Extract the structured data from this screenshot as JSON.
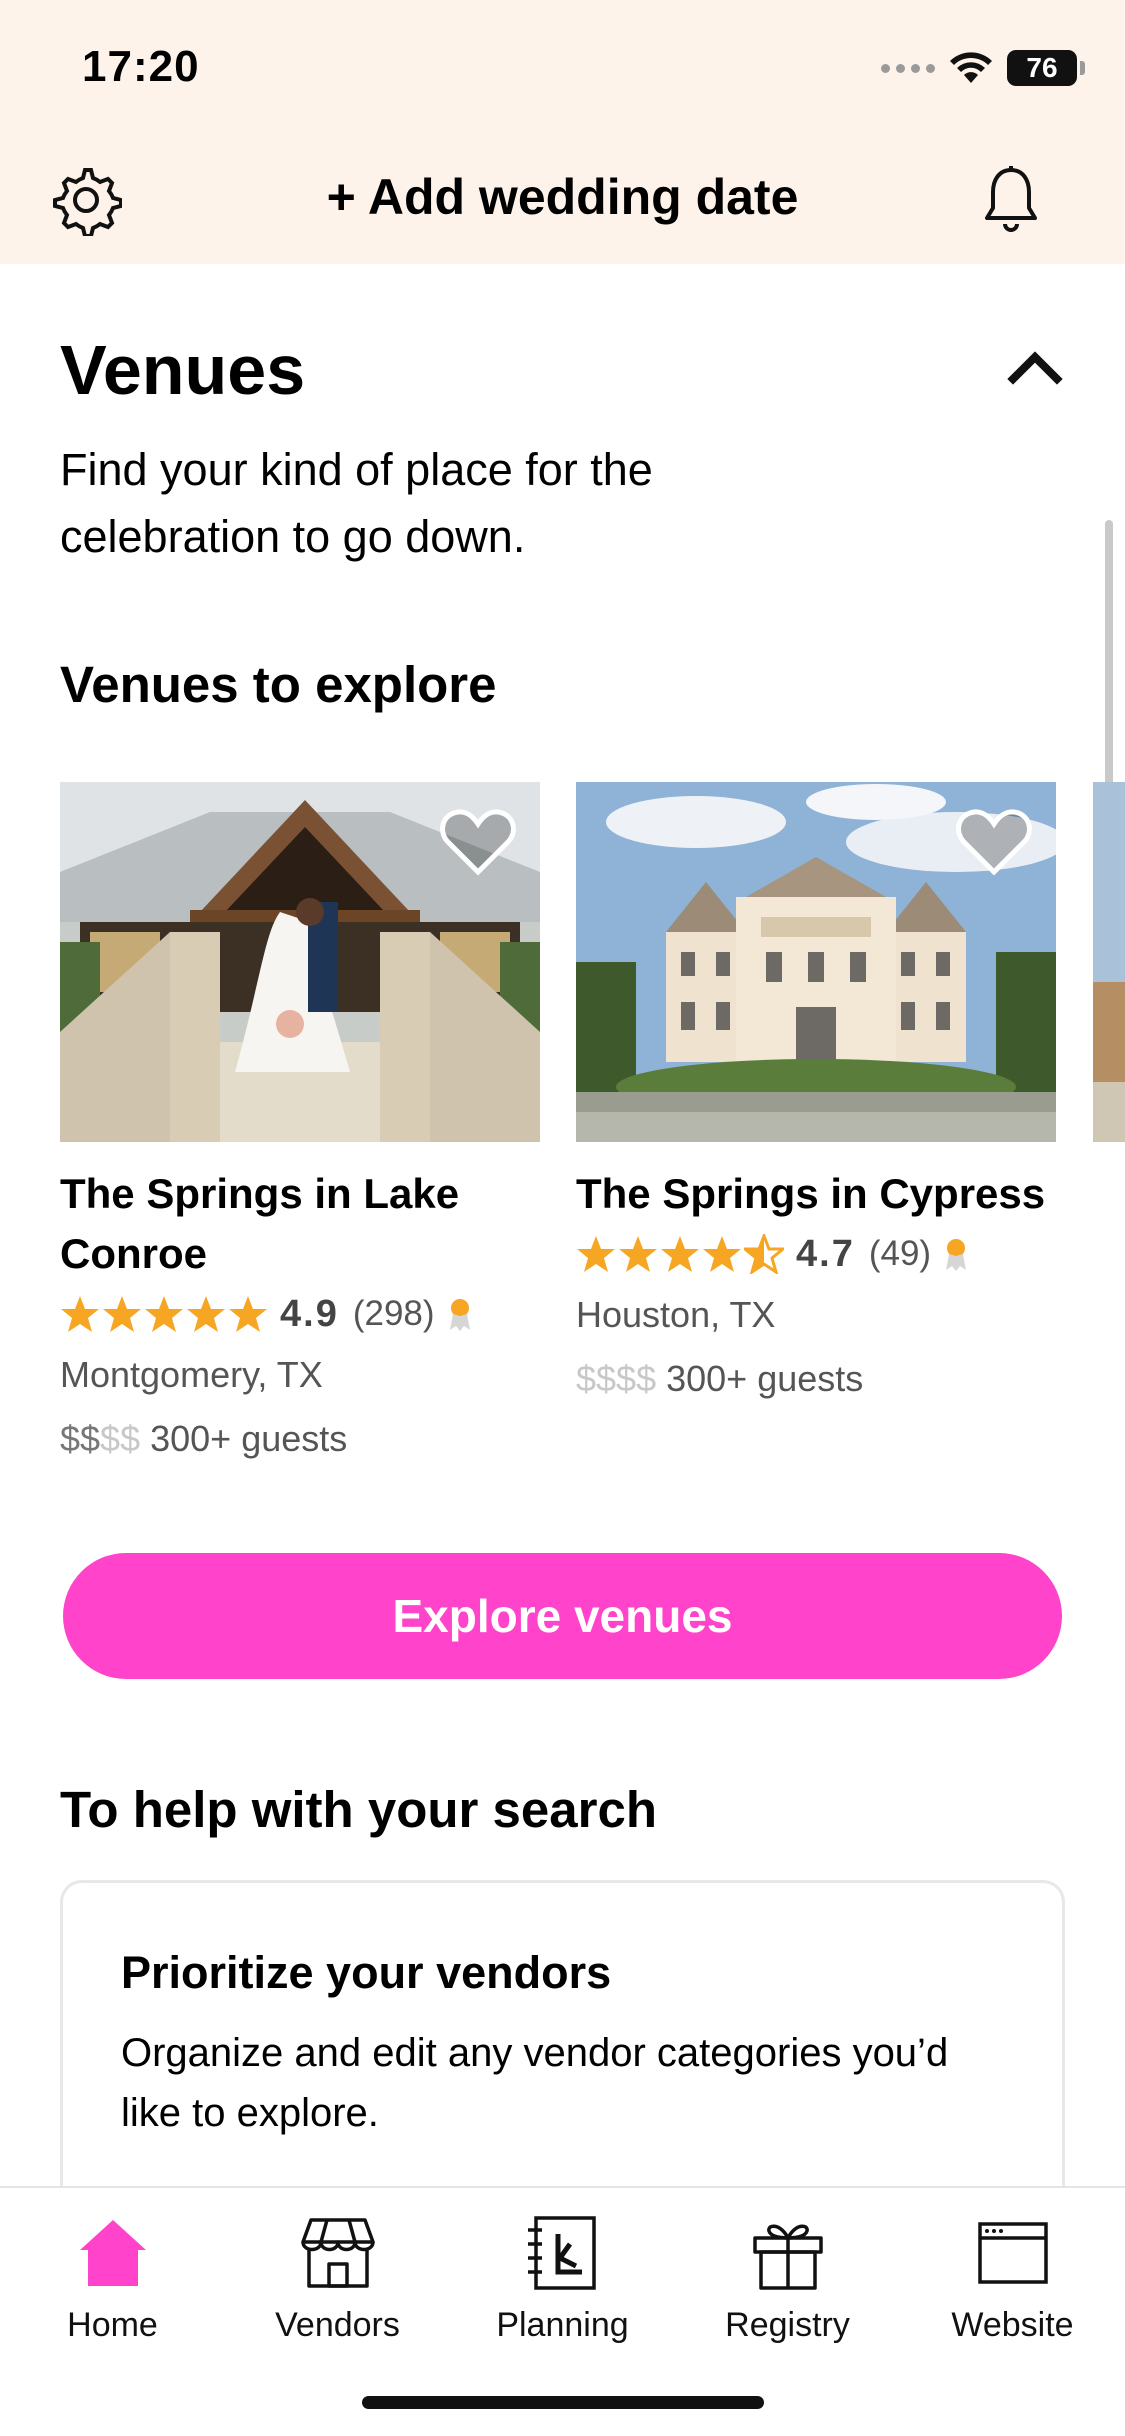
{
  "status_bar": {
    "time": "17:20",
    "battery": "76"
  },
  "header": {
    "title": "+ Add wedding date"
  },
  "section": {
    "title": "Venues",
    "subtitle": "Find your kind of place for the celebration to go down.",
    "explore_title": "Venues to explore"
  },
  "venues": [
    {
      "name": "The Springs in Lake Conroe",
      "rating": "4.9",
      "reviews": "(298)",
      "location": "Montgomery, TX",
      "price_active": "$$",
      "price_inactive": "$$",
      "guests": "300+ guests",
      "stars": 5
    },
    {
      "name": "The Springs in Cypress",
      "rating": "4.7",
      "reviews": "(49)",
      "location": "Houston, TX",
      "price_active": "$$$$",
      "price_inactive": "",
      "guests": "300+ guests",
      "stars": 4.5
    }
  ],
  "explore_button": "Explore venues",
  "help": {
    "title": "To help with your search",
    "card_title": "Prioritize your vendors",
    "card_text": "Organize and edit any vendor categories you’d like to explore."
  },
  "tabs": [
    {
      "label": "Home",
      "icon": "home-icon",
      "active": true
    },
    {
      "label": "Vendors",
      "icon": "storefront-icon",
      "active": false
    },
    {
      "label": "Planning",
      "icon": "planner-book-icon",
      "active": false
    },
    {
      "label": "Registry",
      "icon": "gift-icon",
      "active": false
    },
    {
      "label": "Website",
      "icon": "browser-window-icon",
      "active": false
    }
  ],
  "colors": {
    "accent": "#ff44cb",
    "header_bg": "#fdf3ea",
    "star": "#f6a623"
  }
}
